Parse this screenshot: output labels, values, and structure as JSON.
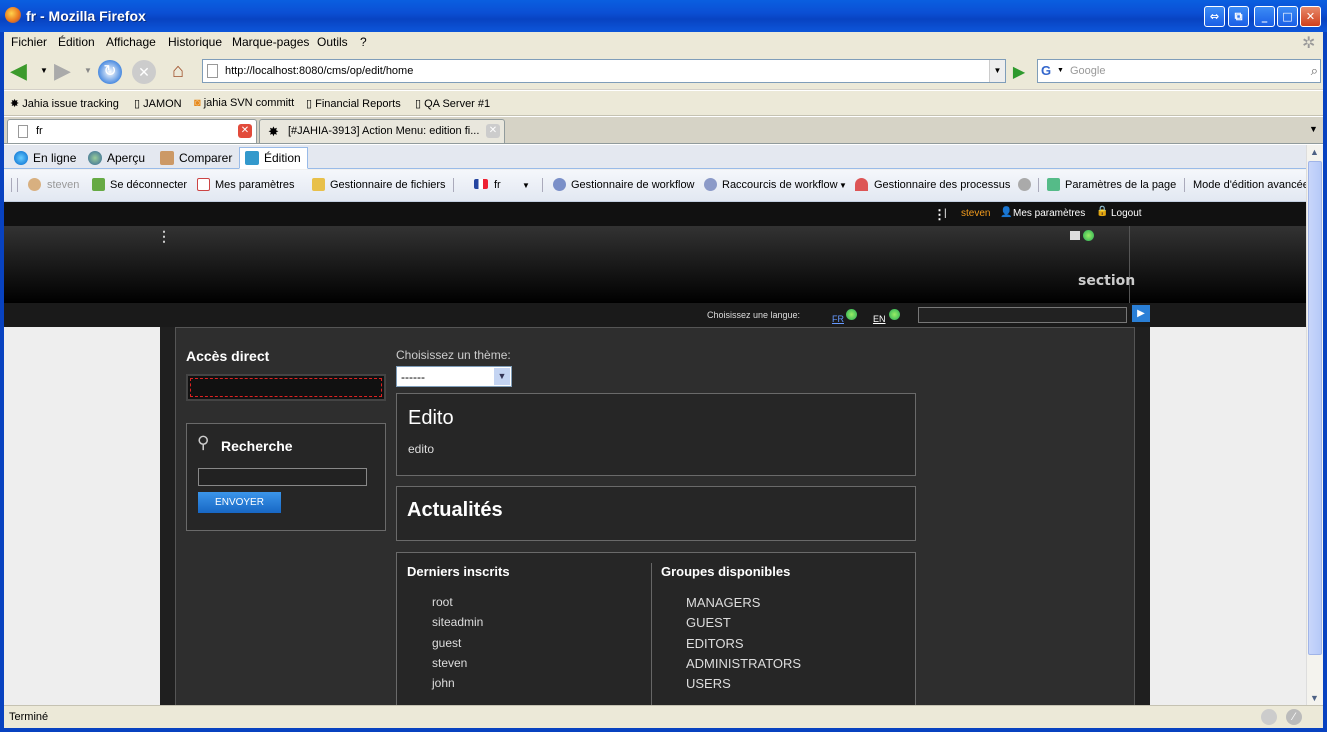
{
  "window": {
    "title": "fr - Mozilla Firefox"
  },
  "menu": [
    "Fichier",
    "Édition",
    "Affichage",
    "Historique",
    "Marque-pages",
    "Outils",
    "?"
  ],
  "nav": {
    "url": "http://localhost:8080/cms/op/edit/home",
    "search_placeholder": "Google"
  },
  "bookmarks": [
    "Jahia issue tracking",
    "JAMON",
    "jahia SVN committ",
    "Financial Reports",
    "QA Server #1"
  ],
  "tabs": [
    {
      "label": "fr"
    },
    {
      "label": "[#JAHIA-3913] Action Menu: edition fi..."
    }
  ],
  "mode_tabs": [
    "En ligne",
    "Aperçu",
    "Comparer",
    "Édition"
  ],
  "jahia_toolbar": {
    "user": "steven",
    "items": [
      "Se déconnecter",
      "Mes paramètres",
      "Gestionnaire de fichiers",
      "fr",
      "Gestionnaire de workflow",
      "Raccourcis de workflow",
      "Gestionnaire des processus",
      "Paramètres de la page",
      "Mode d'édition avancée"
    ]
  },
  "site": {
    "top_user": "steven",
    "top_settings": "Mes paramètres",
    "top_logout": "Logout",
    "section_label": "section",
    "lang_prompt": "Choisissez une langue:",
    "lang_fr": "FR",
    "lang_en": "EN",
    "direct_access": "Accès direct",
    "search_title": "Recherche",
    "search_button": "ENVOYER",
    "theme_prompt": "Choisissez un thème:",
    "theme_value": "------",
    "edito_title": "Edito",
    "edito_text": "edito",
    "news_title": "Actualités",
    "members_title": "Derniers inscrits",
    "members": [
      "root",
      "siteadmin",
      "guest",
      "steven",
      "john"
    ],
    "groups_title": "Groupes disponibles",
    "groups": [
      "MANAGERS",
      "GUEST",
      "EDITORS",
      "ADMINISTRATORS",
      "USERS"
    ]
  },
  "status": "Terminé"
}
